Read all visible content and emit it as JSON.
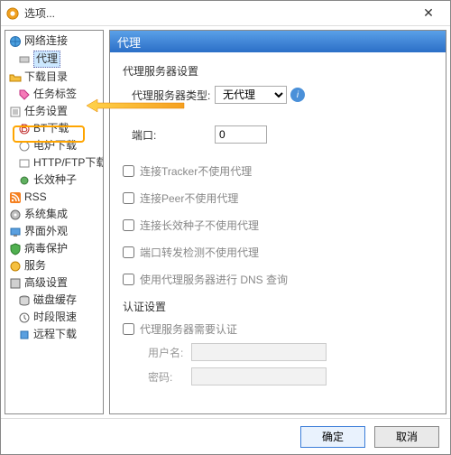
{
  "window": {
    "title": "选项..."
  },
  "sidebar": {
    "items": [
      {
        "label": "网络连接"
      },
      {
        "label": "代理"
      },
      {
        "label": "下载目录"
      },
      {
        "label": "任务标签"
      },
      {
        "label": "任务设置"
      },
      {
        "label": "BT下载"
      },
      {
        "label": "电炉下载"
      },
      {
        "label": "HTTP/FTP下载"
      },
      {
        "label": "长效种子"
      },
      {
        "label": "RSS"
      },
      {
        "label": "系统集成"
      },
      {
        "label": "界面外观"
      },
      {
        "label": "病毒保护"
      },
      {
        "label": "服务"
      },
      {
        "label": "高级设置"
      },
      {
        "label": "磁盘缓存"
      },
      {
        "label": "时段限速"
      },
      {
        "label": "远程下载"
      }
    ]
  },
  "main": {
    "title": "代理",
    "section_proxy": "代理服务器设置",
    "proxy_type_label": "代理服务器类型:",
    "proxy_type_value": "无代理",
    "port_label": "端口:",
    "port_value": "0",
    "chk_tracker": "连接Tracker不使用代理",
    "chk_peer": "连接Peer不使用代理",
    "chk_longseed": "连接长效种子不使用代理",
    "chk_portcheck": "端口转发检测不使用代理",
    "chk_dns": "使用代理服务器进行 DNS 查询",
    "section_auth": "认证设置",
    "chk_auth": "代理服务器需要认证",
    "user_label": "用户名:",
    "pass_label": "密码:"
  },
  "buttons": {
    "ok": "确定",
    "cancel": "取消"
  }
}
